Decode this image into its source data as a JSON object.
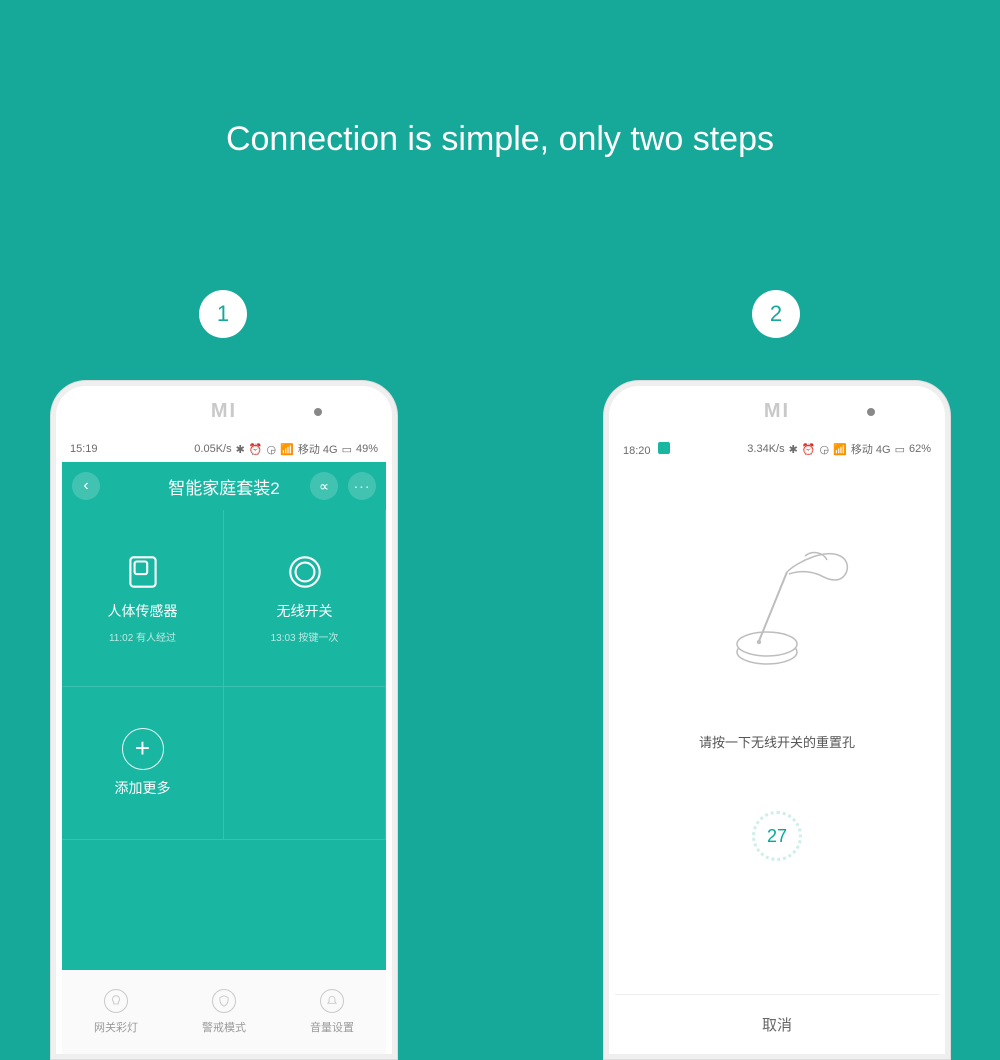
{
  "headline": "Connection is simple, only two steps",
  "steps": {
    "one": "1",
    "two": "2"
  },
  "brand": "MI",
  "phone1": {
    "status": {
      "time": "15:19",
      "speed": "0.05K/s",
      "net": "移动 4G",
      "battery": "49%"
    },
    "header": {
      "title": "智能家庭套装2",
      "back": "‹",
      "share": "∝",
      "more": "···"
    },
    "cells": {
      "sensor": {
        "label": "人体传感器",
        "sub": "11:02 有人经过"
      },
      "switch": {
        "label": "无线开关",
        "sub": "13:03 按键一次"
      },
      "add": {
        "label": "添加更多",
        "plus": "+"
      }
    },
    "bottom": {
      "light": "网关彩灯",
      "alert": "警戒模式",
      "volume": "音量设置"
    }
  },
  "phone2": {
    "status": {
      "time": "18:20",
      "speed": "3.34K/s",
      "net": "移动 4G",
      "battery": "62%"
    },
    "instruction": "请按一下无线开关的重置孔",
    "countdown": "27",
    "cancel": "取消"
  }
}
